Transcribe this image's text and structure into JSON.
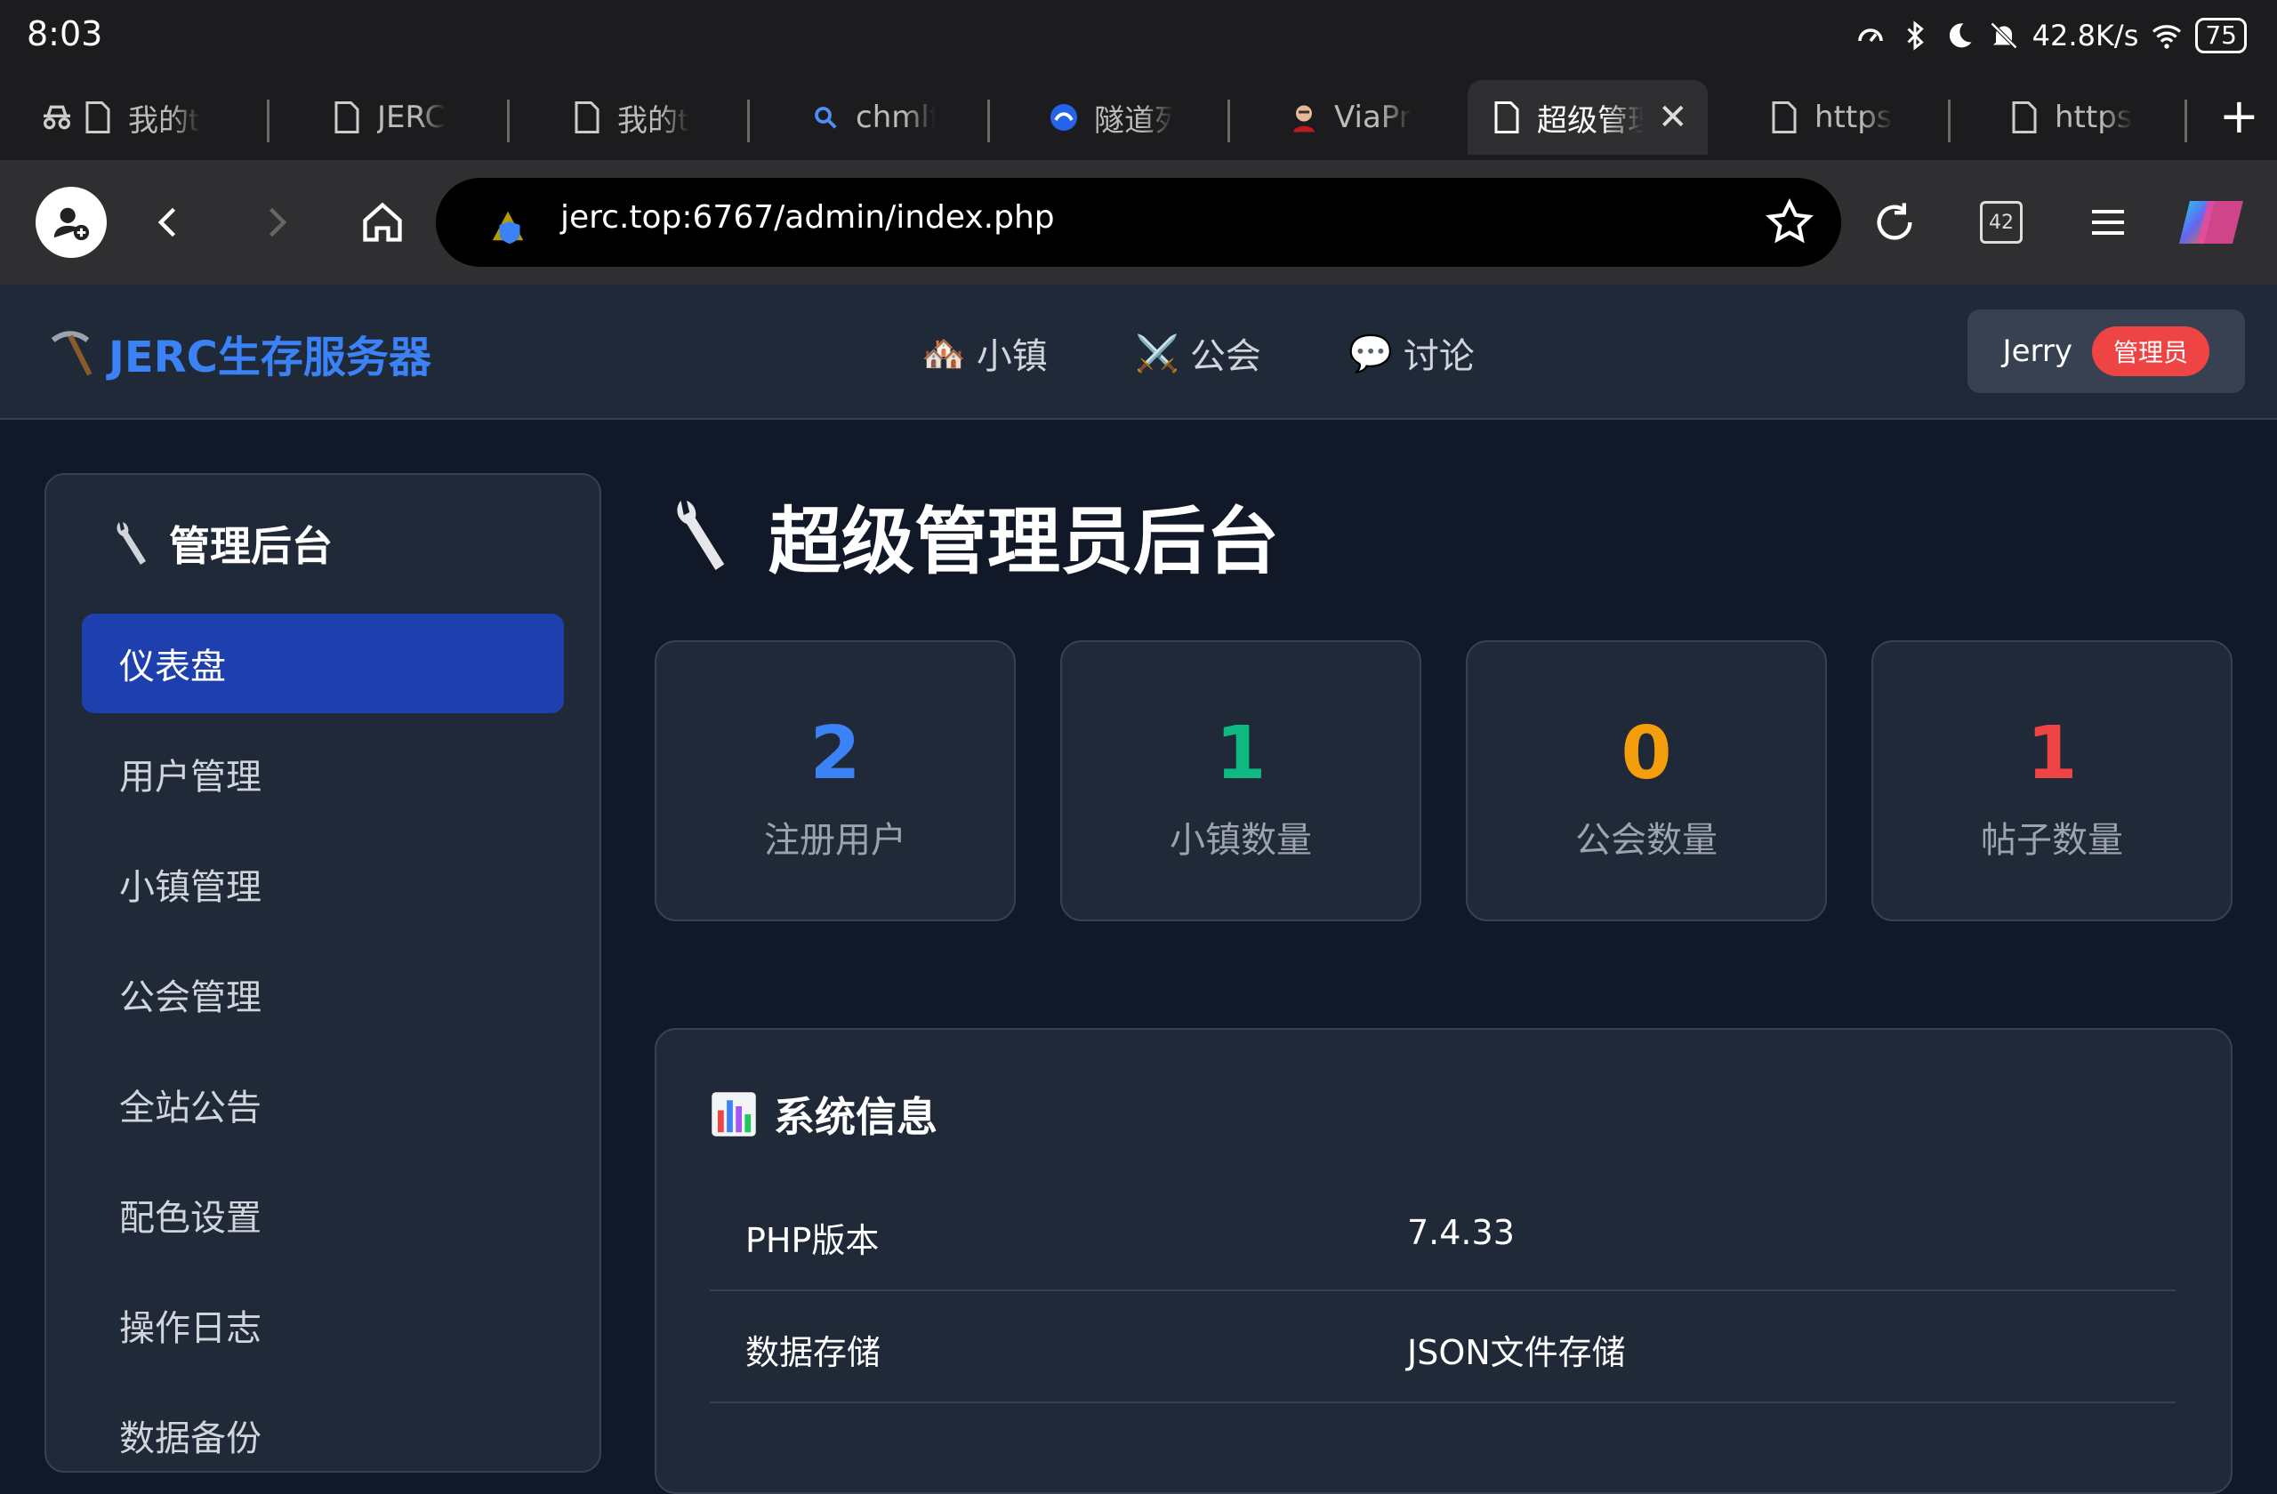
{
  "status_bar": {
    "time": "8:03",
    "speed": "42.8K/s",
    "battery": "75",
    "icons": [
      "speedometer-icon",
      "bluetooth-icon",
      "moon-icon",
      "bell-off-icon",
      "wifi-icon",
      "battery-icon"
    ]
  },
  "tabs": [
    {
      "label": "我的t",
      "icon": "document-icon"
    },
    {
      "label": "JERC",
      "icon": "document-icon"
    },
    {
      "label": "我的t",
      "icon": "document-icon"
    },
    {
      "label": "chmlf",
      "icon": "search-icon"
    },
    {
      "label": "隧道列",
      "icon": "site-logo-icon"
    },
    {
      "label": "ViaPr",
      "icon": "avatar-icon"
    },
    {
      "label": "超级管理",
      "icon": "document-icon",
      "active": true
    },
    {
      "label": "https",
      "icon": "document-icon"
    },
    {
      "label": "https",
      "icon": "document-icon"
    }
  ],
  "toolbar": {
    "url": "jerc.top:6767/admin/index.php",
    "tab_count": "42"
  },
  "site": {
    "brand": "JERC生存服务器",
    "nav": [
      {
        "label": "小镇",
        "emoji": "🏘️"
      },
      {
        "label": "公会",
        "emoji": "⚔️"
      },
      {
        "label": "讨论",
        "emoji": "💬"
      }
    ],
    "user": {
      "name": "Jerry",
      "role": "管理员"
    }
  },
  "sidebar": {
    "title": "管理后台",
    "items": [
      {
        "label": "仪表盘",
        "active": true
      },
      {
        "label": "用户管理"
      },
      {
        "label": "小镇管理"
      },
      {
        "label": "公会管理"
      },
      {
        "label": "全站公告"
      },
      {
        "label": "配色设置"
      },
      {
        "label": "操作日志"
      },
      {
        "label": "数据备份"
      }
    ]
  },
  "main": {
    "title": "超级管理员后台",
    "stats": [
      {
        "value": "2",
        "label": "注册用户",
        "color": "#3b82f6"
      },
      {
        "value": "1",
        "label": "小镇数量",
        "color": "#10b981"
      },
      {
        "value": "0",
        "label": "公会数量",
        "color": "#f59e0b"
      },
      {
        "value": "1",
        "label": "帖子数量",
        "color": "#ef4444"
      }
    ],
    "system_info": {
      "title": "系统信息",
      "rows": [
        {
          "key": "PHP版本",
          "value": "7.4.33"
        },
        {
          "key": "数据存储",
          "value": "JSON文件存储"
        }
      ]
    }
  }
}
